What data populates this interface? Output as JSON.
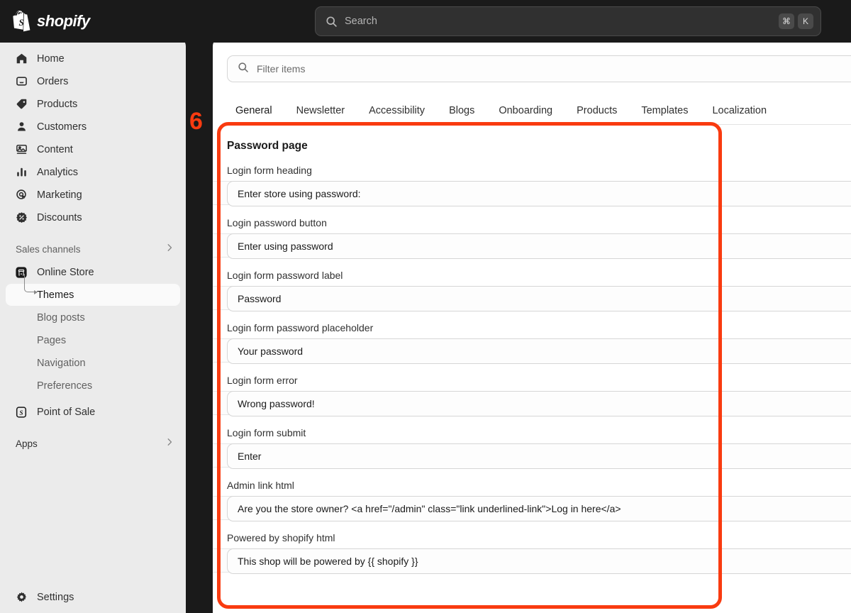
{
  "topbar": {
    "brand": "shopify",
    "brand_icon": "shopify-bag-icon",
    "search": {
      "icon": "search-icon",
      "placeholder": "Search",
      "shortcut_modifier": "⌘",
      "shortcut_key": "K"
    }
  },
  "sidebar": {
    "items": [
      {
        "label": "Home",
        "icon": "home-icon"
      },
      {
        "label": "Orders",
        "icon": "orders-inbox-icon"
      },
      {
        "label": "Products",
        "icon": "product-tag-icon"
      },
      {
        "label": "Customers",
        "icon": "customer-person-icon"
      },
      {
        "label": "Content",
        "icon": "content-image-icon"
      },
      {
        "label": "Analytics",
        "icon": "analytics-bars-icon"
      },
      {
        "label": "Marketing",
        "icon": "marketing-target-icon"
      },
      {
        "label": "Discounts",
        "icon": "discount-badge-icon"
      }
    ],
    "sales_channels": {
      "label": "Sales channels",
      "chevron": "chevron-right-icon"
    },
    "online_store": {
      "label": "Online Store",
      "icon": "online-store-icon"
    },
    "store_children": [
      {
        "label": "Themes",
        "active": true
      },
      {
        "label": "Blog posts",
        "active": false
      },
      {
        "label": "Pages",
        "active": false
      },
      {
        "label": "Navigation",
        "active": false
      },
      {
        "label": "Preferences",
        "active": false
      }
    ],
    "point_of_sale": {
      "label": "Point of Sale",
      "icon": "point-of-sale-icon"
    },
    "apps": {
      "label": "Apps",
      "chevron": "chevron-right-icon"
    },
    "settings": {
      "label": "Settings",
      "icon": "gear-icon"
    }
  },
  "main": {
    "filter": {
      "icon": "search-icon",
      "placeholder": "Filter items"
    },
    "tabs": [
      {
        "label": "General",
        "active": true
      },
      {
        "label": "Newsletter",
        "active": false
      },
      {
        "label": "Accessibility",
        "active": false
      },
      {
        "label": "Blogs",
        "active": false
      },
      {
        "label": "Onboarding",
        "active": false
      },
      {
        "label": "Products",
        "active": false
      },
      {
        "label": "Templates",
        "active": false
      },
      {
        "label": "Localization",
        "active": false
      }
    ],
    "section_title": "Password page",
    "fields": [
      {
        "label": "Login form heading",
        "value": "Enter store using password:"
      },
      {
        "label": "Login password button",
        "value": "Enter using password"
      },
      {
        "label": "Login form password label",
        "value": "Password"
      },
      {
        "label": "Login form password placeholder",
        "value": "Your password"
      },
      {
        "label": "Login form error",
        "value": "Wrong password!"
      },
      {
        "label": "Login form submit",
        "value": "Enter"
      },
      {
        "label": "Admin link html",
        "value": "Are you the store owner? <a href=\"/admin\" class=\"link underlined-link\">Log in here</a>"
      },
      {
        "label": "Powered by shopify html",
        "value": "This shop will be powered by {{ shopify }}"
      }
    ]
  },
  "annotation": {
    "number": "6",
    "color": "#f93b10"
  }
}
